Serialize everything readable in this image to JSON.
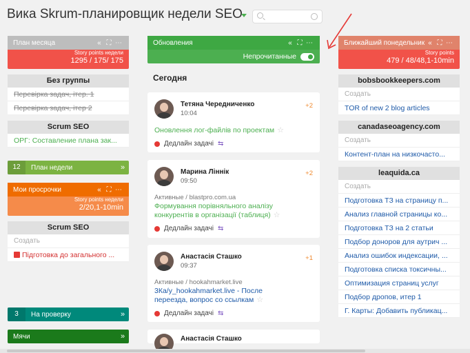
{
  "board": {
    "title": "Вика Skrum-планировщик недели SEO"
  },
  "search": {
    "placeholder": ""
  },
  "colors": {
    "green": "#4caf50",
    "red": "#f15249",
    "orange": "#ef6c00",
    "teal": "#00897b",
    "dark_green": "#1b7a1b",
    "olive": "#7cb342"
  },
  "left": {
    "plan_month": {
      "title": "План месяца",
      "sub": "Story points недели",
      "value": "1295 / 175/ 175"
    },
    "no_group": {
      "title": "Без группы",
      "items": [
        "Перевірка задач, ітер. 1",
        "Перевірка задач, ітер 2"
      ]
    },
    "scrum1": {
      "title": "Scrum SEO",
      "item": "ОРГ: Составление плана зак..."
    },
    "plan_week_bar": {
      "num": "12",
      "label": "План недели",
      "arrow": "»"
    },
    "overdue": {
      "title": "Мои просрочки",
      "sub": "Story points недели",
      "value": "2/20,1-10min"
    },
    "scrum2": {
      "title": "Scrum SEO",
      "create": "Создать",
      "item": "Підготовка до загального ..."
    },
    "review_bar": {
      "num": "3",
      "label": "На проверку",
      "arrow": "»"
    },
    "balls_bar": {
      "label": "Мячи",
      "arrow": "»"
    }
  },
  "mid": {
    "header": {
      "title": "Обновления",
      "unread": "Непрочитанные"
    },
    "today": "Сегодня",
    "cards": [
      {
        "name": "Тетяна Чередниченко",
        "time": "10:04",
        "plus": "+2",
        "ctx": "",
        "task": "Оновлення лог-файлів по проектам",
        "deadline": "Дедлайн задачі"
      },
      {
        "name": "Марина Ліннік",
        "time": "09:50",
        "plus": "+2",
        "ctx": "Активные / blastpro.com.ua",
        "task": "Формування порівняльного аналізу конкурентів в організації (таблиця)",
        "deadline": "Дедлайн задачі"
      },
      {
        "name": "Анастасія Сташко",
        "time": "09:37",
        "plus": "+1",
        "ctx": "Активные / hookahmarket.live",
        "task": "3Ка/у_hookahmarket.live - После переезда, вопрос со ссылкам",
        "deadline": "Дедлайн задачі"
      },
      {
        "name": "Анастасія Сташко",
        "time": "",
        "plus": "",
        "ctx": "",
        "task": "",
        "deadline": ""
      }
    ],
    "ctrl": {
      "collapse": "«",
      "expand": "⛶",
      "more": "⋯"
    }
  },
  "right": {
    "monday": {
      "title": "Ближайший понедельник",
      "sub": "Story points",
      "value": "479 / 48/48,1-10min"
    },
    "groups": [
      {
        "title": "bobsbookkeepers.com",
        "create": "Создать",
        "items": [
          "TOR of new 2 blog articles"
        ]
      },
      {
        "title": "canadaseoagency.com",
        "create": "Создать",
        "items": [
          "Контент-план на низкочасто..."
        ]
      },
      {
        "title": "leaquida.ca",
        "create": "Создать",
        "items": [
          "Подготовка ТЗ на страницу п...",
          "Анализ главной страницы ко...",
          "Подготовка ТЗ на 2 статьи",
          "Подбор доноров для аутрич ...",
          "Анализ ошибок индексации, ...",
          "Подготовка списка токсичны...",
          "Оптимизация страниц услуг",
          "Подбор дропов, итер 1",
          "Г. Карты: Добавить публикац..."
        ]
      }
    ]
  }
}
